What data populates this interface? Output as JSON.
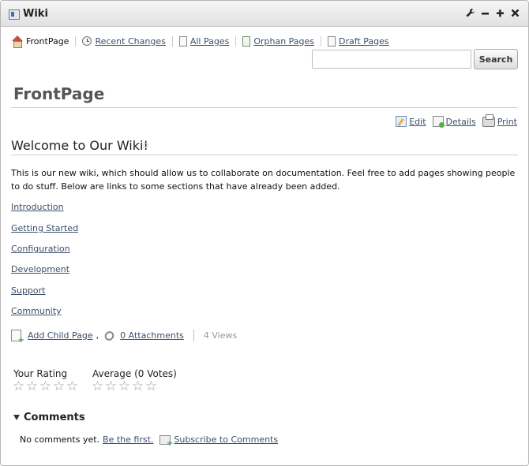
{
  "portlet": {
    "title": "Wiki"
  },
  "titlebar_icons": [
    "wrench-icon",
    "minimize-icon",
    "maximize-icon",
    "close-icon"
  ],
  "nav": {
    "front_page": "FrontPage",
    "recent_changes": "Recent Changes",
    "all_pages": "All Pages",
    "orphan_pages": "Orphan Pages",
    "draft_pages": "Draft Pages"
  },
  "search": {
    "value": "",
    "button": "Search"
  },
  "page": {
    "title": "FrontPage",
    "actions": {
      "edit": "Edit",
      "details": "Details",
      "print": "Print"
    },
    "heading": "Welcome to Our Wiki!",
    "intro": "This is our new wiki, which should allow us to collaborate on documentation. Feel free to add pages showing people to do stuff. Below are links to some sections that have already been added.",
    "sections": [
      "Introduction",
      "Getting Started",
      "Configuration",
      "Development",
      "Support",
      "Community"
    ]
  },
  "footer": {
    "add_child_page": "Add Child Page",
    "separator": ",",
    "attachments": "0 Attachments",
    "views": "4 Views"
  },
  "ratings": {
    "your_rating_label": "Your Rating",
    "your_rating_stars": 0,
    "average_label": "Average (0 Votes)",
    "average_stars": 0,
    "max_stars": 5
  },
  "comments": {
    "title": "Comments",
    "empty_text": "No comments yet.",
    "be_first": "Be the first.",
    "subscribe": "Subscribe to Comments"
  }
}
